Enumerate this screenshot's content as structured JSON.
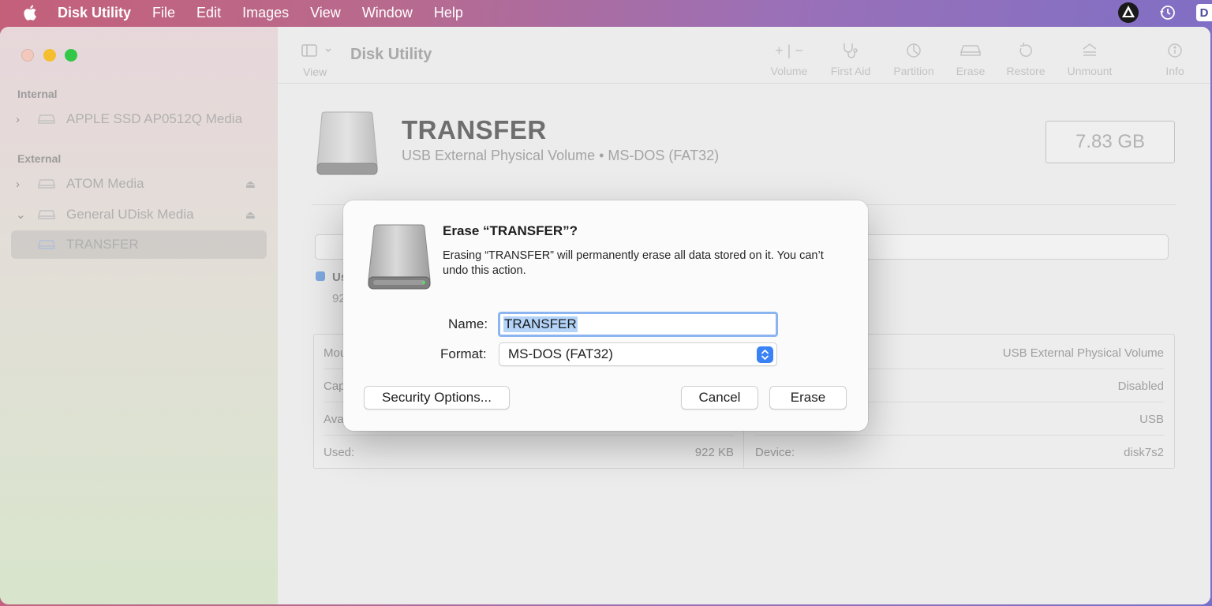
{
  "menubar": {
    "app_name": "Disk Utility",
    "items": [
      "File",
      "Edit",
      "Images",
      "View",
      "Window",
      "Help"
    ],
    "right_badge": "D"
  },
  "sidebar": {
    "internal_header": "Internal",
    "external_header": "External",
    "items": [
      {
        "label": "APPLE SSD AP0512Q Media"
      },
      {
        "label": "ATOM Media"
      },
      {
        "label": "General UDisk Media"
      },
      {
        "label": "TRANSFER"
      }
    ]
  },
  "toolbar": {
    "view_label": "View",
    "title": "Disk Utility",
    "buttons": [
      {
        "label": "Volume",
        "icon": "plus-minus-icon"
      },
      {
        "label": "First Aid",
        "icon": "stethoscope-icon"
      },
      {
        "label": "Partition",
        "icon": "pie-chart-icon"
      },
      {
        "label": "Erase",
        "icon": "erase-icon"
      },
      {
        "label": "Restore",
        "icon": "restore-icon"
      },
      {
        "label": "Unmount",
        "icon": "unmount-icon"
      },
      {
        "label": "Info",
        "icon": "info-icon"
      }
    ]
  },
  "volume": {
    "name": "TRANSFER",
    "description": "USB External Physical Volume • MS-DOS (FAT32)",
    "size": "7.83 GB",
    "usage_label": "Us",
    "usage_value": "92",
    "usage_color": "#7fa9e0"
  },
  "info": {
    "left": [
      {
        "key": "Mou",
        "value": ""
      },
      {
        "key": "Cap",
        "value": ""
      },
      {
        "key": "Ava",
        "value": ""
      },
      {
        "key": "Used:",
        "value": "922 KB"
      }
    ],
    "right": [
      {
        "key": "",
        "value": "USB External Physical Volume"
      },
      {
        "key": "",
        "value": "Disabled"
      },
      {
        "key": "",
        "value": "USB"
      },
      {
        "key": "Device:",
        "value": "disk7s2"
      }
    ]
  },
  "dialog": {
    "title": "Erase “TRANSFER”?",
    "message": "Erasing “TRANSFER” will permanently erase all data stored on it. You can’t undo this action.",
    "name_label": "Name:",
    "name_value": "TRANSFER",
    "format_label": "Format:",
    "format_value": "MS-DOS (FAT32)",
    "security_button": "Security Options...",
    "cancel_button": "Cancel",
    "erase_button": "Erase",
    "accent_color": "#3b82f6"
  }
}
